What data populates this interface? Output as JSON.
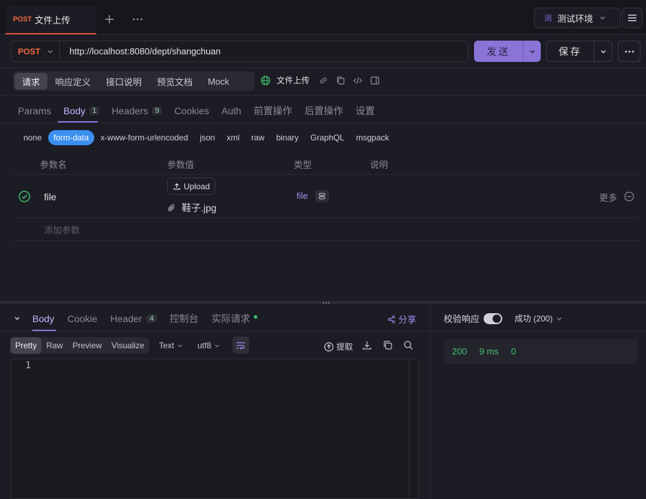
{
  "tab": {
    "method": "POST",
    "title": "文件上传"
  },
  "env": {
    "badge": "测",
    "label": "测试环境"
  },
  "request": {
    "method": "POST",
    "url": "http://localhost:8080/dept/shangchuan",
    "send_label": "发送",
    "save_label": "保存"
  },
  "segments": [
    "请求",
    "响应定义",
    "接口说明",
    "预览文档",
    "Mock"
  ],
  "doc_title": "文件上传",
  "param_tabs": [
    {
      "label": "Params",
      "count": ""
    },
    {
      "label": "Body",
      "count": "1"
    },
    {
      "label": "Headers",
      "count": "9"
    },
    {
      "label": "Cookies",
      "count": ""
    },
    {
      "label": "Auth",
      "count": ""
    },
    {
      "label": "前置操作",
      "count": ""
    },
    {
      "label": "后置操作",
      "count": ""
    },
    {
      "label": "设置",
      "count": ""
    }
  ],
  "body_types": [
    "none",
    "form-data",
    "x-www-form-urlencoded",
    "json",
    "xml",
    "raw",
    "binary",
    "GraphQL",
    "msgpack"
  ],
  "table": {
    "headers": [
      "参数名",
      "参数值",
      "类型",
      "说明"
    ],
    "rows": [
      {
        "name": "file",
        "upload_label": "Upload",
        "file_name": "鞋子.jpg",
        "type": "file",
        "more": "更多"
      }
    ],
    "add_placeholder": "添加参数"
  },
  "response": {
    "tabs": [
      {
        "label": "Body",
        "count": ""
      },
      {
        "label": "Cookie",
        "count": ""
      },
      {
        "label": "Header",
        "count": "4"
      },
      {
        "label": "控制台",
        "count": ""
      },
      {
        "label": "实际请求",
        "count": ""
      }
    ],
    "share": "分享",
    "formats": [
      "Pretty",
      "Raw",
      "Preview",
      "Visualize"
    ],
    "text_mode": "Text",
    "encoding": "utf8",
    "extract": "提取",
    "line_number": "1",
    "validate": "校验响应",
    "status_select": "成功 (200)",
    "stats": {
      "status": "200",
      "time": "9 ms",
      "size": "0"
    }
  },
  "colors": {
    "accent": "#8a74d8",
    "post": "#f06a3c",
    "success": "#3fc46f",
    "form_data": "#3a8ff0"
  }
}
